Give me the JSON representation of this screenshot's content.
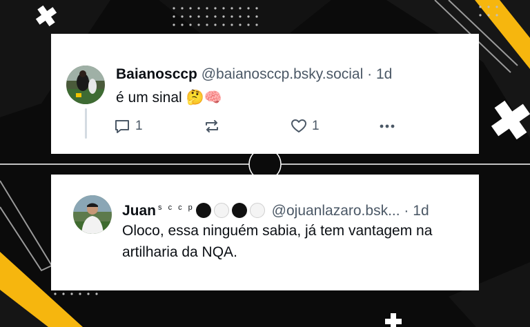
{
  "posts": [
    {
      "author_name": "Baianosccp",
      "author_handle": "@baianosccp.bsky.social",
      "separator": "·",
      "time": "1d",
      "text": "é um sinal 🤔🧠",
      "reply_count": "1",
      "like_count": "1"
    },
    {
      "author_name": "Juan",
      "name_superscript": "s c c p",
      "author_handle": "@ojuanlazaro.bsk...",
      "separator": "·",
      "time": "1d",
      "text": "Oloco, essa ninguém sabia, já tem vantagem na artilharia da NQA."
    }
  ],
  "icons": {
    "reply": "reply-icon",
    "repost": "repost-icon",
    "like": "heart-icon",
    "more": "more-options-icon"
  },
  "colors": {
    "accent_yellow": "#f6b60e",
    "background": "#0b0b0b",
    "card": "#ffffff",
    "muted_text": "#4b5866"
  }
}
